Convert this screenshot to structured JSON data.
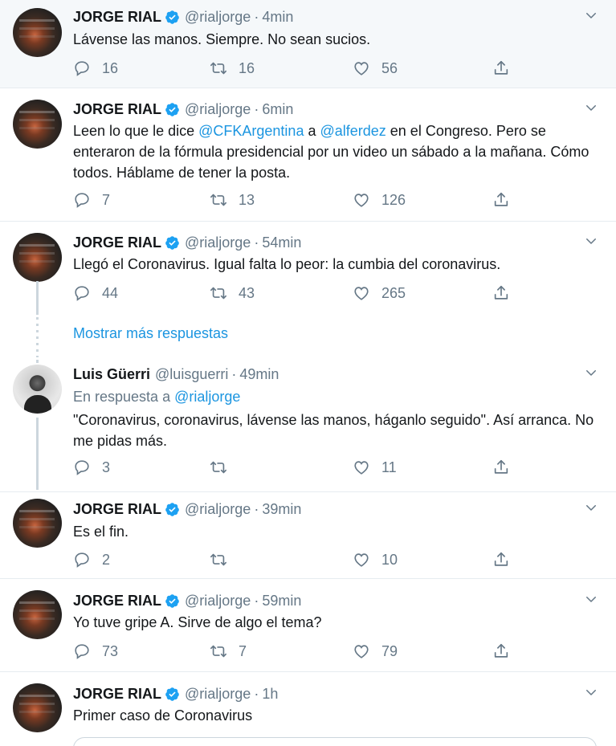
{
  "tweets": [
    {
      "name": "JORGE RIAL",
      "handle": "@rialjorge",
      "time": "4min",
      "text": "Lávense las manos. Siempre. No sean sucios.",
      "replies": "16",
      "retweets": "16",
      "likes": "56"
    },
    {
      "name": "JORGE RIAL",
      "handle": "@rialjorge",
      "time": "6min",
      "text_parts": [
        "Leen lo que le dice ",
        "@CFKArgentina",
        " a ",
        "@alferdez",
        " en el Congreso. Pero se enteraron de la fórmula presidencial por un video un sábado a la mañana. Cómo todos. Háblame de tener la posta."
      ],
      "replies": "7",
      "retweets": "13",
      "likes": "126"
    },
    {
      "name": "JORGE RIAL",
      "handle": "@rialjorge",
      "time": "54min",
      "text": "Llegó el Coronavirus. Igual falta lo peor: la cumbia del coronavirus.",
      "replies": "44",
      "retweets": "43",
      "likes": "265"
    },
    {
      "name": "Luis Güerri",
      "handle": "@luisguerri",
      "time": "49min",
      "reply_prefix": "En respuesta a ",
      "reply_to": "@rialjorge",
      "text": "\"Coronavirus, coronavirus, lávense las manos, háganlo seguido\". Así arranca. No me pidas más.",
      "replies": "3",
      "retweets": "",
      "likes": "11"
    },
    {
      "name": "JORGE RIAL",
      "handle": "@rialjorge",
      "time": "39min",
      "text": "Es el fin.",
      "replies": "2",
      "retweets": "",
      "likes": "10"
    },
    {
      "name": "JORGE RIAL",
      "handle": "@rialjorge",
      "time": "59min",
      "text": "Yo tuve gripe A. Sirve de algo el tema?",
      "replies": "73",
      "retweets": "7",
      "likes": "79"
    },
    {
      "name": "JORGE RIAL",
      "handle": "@rialjorge",
      "time": "1h",
      "text": "Primer caso de Coronavirus"
    }
  ],
  "show_more_label": "Mostrar más respuestas",
  "separator": "·",
  "colors": {
    "link": "#1b95e0",
    "muted": "#657786",
    "verified": "#1da1f2",
    "border": "#e6ecf0"
  }
}
